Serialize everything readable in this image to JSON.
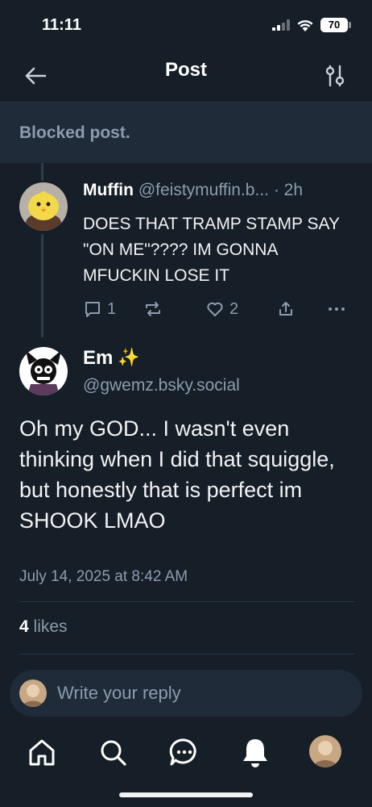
{
  "status_bar": {
    "time": "11:11",
    "battery": "70"
  },
  "header": {
    "title": "Post"
  },
  "blocked": {
    "text": "Blocked post."
  },
  "reply": {
    "name": "Muffin",
    "handle": "@feistymuffin.b...",
    "separator": "·",
    "time": "2h",
    "text": "DOES THAT TRAMP STAMP SAY \"ON ME\"???? IM GONNA MFUCKIN LOSE IT",
    "reply_count": "1",
    "like_count": "2"
  },
  "post": {
    "name": "Em",
    "sparkle": "✨",
    "handle": "@gwemz.bsky.social",
    "text": "Oh my GOD... I wasn't even thinking when I did that squiggle, but honestly that is perfect im SHOOK LMAO",
    "date": "July 14, 2025 at 8:42 AM",
    "likes_count": "4",
    "likes_label": "likes"
  },
  "compose": {
    "placeholder": "Write your reply"
  },
  "tabs": [
    "home",
    "search",
    "chat",
    "notifications",
    "profile"
  ],
  "colors": {
    "background": "#161e27",
    "muted": "#8c9cae",
    "banner": "#1f2b38"
  }
}
